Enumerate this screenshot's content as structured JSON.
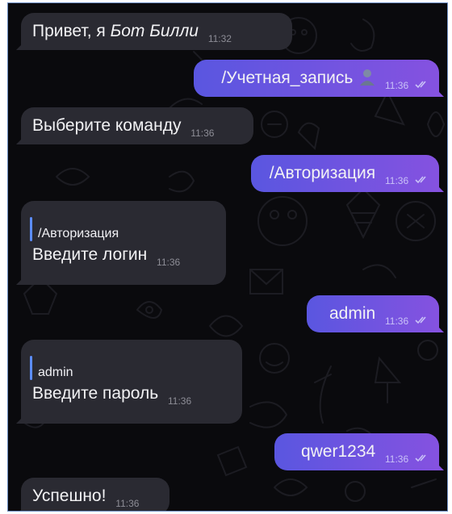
{
  "messages": [
    {
      "sender": "bot",
      "text": "Привет, я ",
      "text_italic": "Бот Билли",
      "time": "11:32"
    },
    {
      "sender": "user",
      "text": "/Учетная_запись",
      "emoji": "bust-in-silhouette",
      "time": "11:36",
      "status": "read"
    },
    {
      "sender": "bot",
      "text": "Выберите команду",
      "time": "11:36"
    },
    {
      "sender": "user",
      "text": "/Авторизация",
      "time": "11:36",
      "status": "read"
    },
    {
      "sender": "bot",
      "reply_to": "/Авторизация",
      "text": "Введите логин",
      "time": "11:36"
    },
    {
      "sender": "user",
      "text": "admin",
      "time": "11:36",
      "status": "read"
    },
    {
      "sender": "bot",
      "reply_to": "admin",
      "text": "Введите пароль",
      "time": "11:36"
    },
    {
      "sender": "user",
      "text": "qwer1234",
      "time": "11:36",
      "status": "read"
    },
    {
      "sender": "bot",
      "text": "Успешно!",
      "time": "11:36"
    }
  ],
  "colors": {
    "background": "#0a0a0d",
    "incoming_bubble": "#2a2a32",
    "outgoing_start": "#5a56e0",
    "outgoing_end": "#8552e0",
    "reply_bar": "#5c8dff"
  }
}
